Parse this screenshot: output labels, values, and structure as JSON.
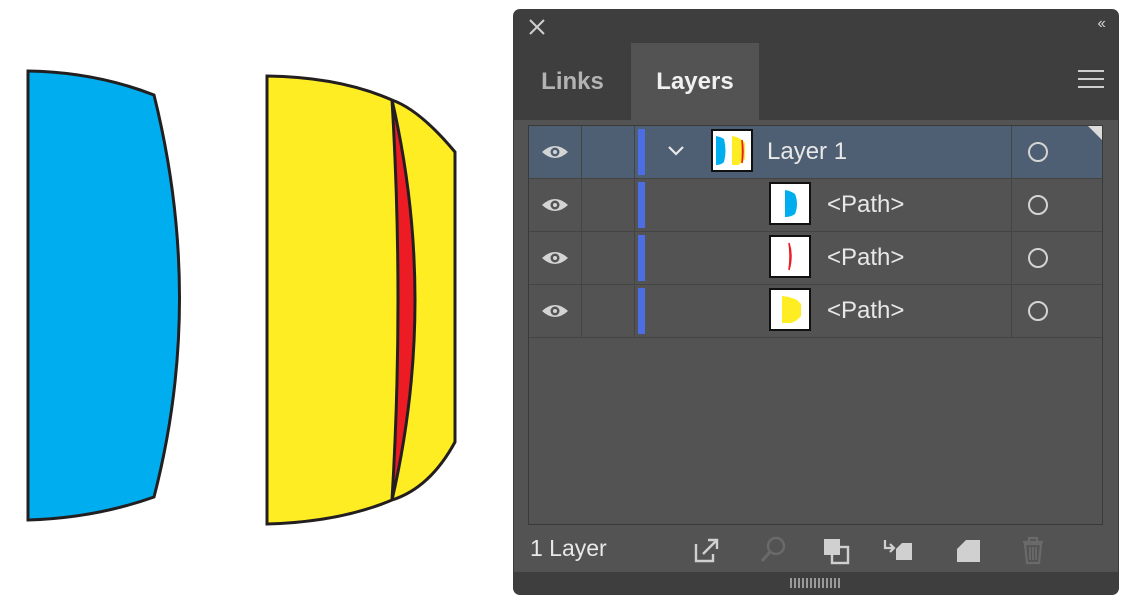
{
  "panel": {
    "tabs": [
      {
        "label": "Links",
        "active": false
      },
      {
        "label": "Layers",
        "active": true
      }
    ],
    "layer_count": "1 Layer",
    "layer_color": "#4c6de3",
    "selection_color": "#4e5f73"
  },
  "layers": [
    {
      "name": "Layer 1",
      "type": "layer",
      "expanded": true,
      "visible": true,
      "selected": true,
      "thumb": "layer-thumb"
    },
    {
      "name": "<Path>",
      "type": "path",
      "visible": true,
      "selected": false,
      "thumb": "blue-shape"
    },
    {
      "name": "<Path>",
      "type": "path",
      "visible": true,
      "selected": false,
      "thumb": "red-shape"
    },
    {
      "name": "<Path>",
      "type": "path",
      "visible": true,
      "selected": false,
      "thumb": "yellow-shape"
    }
  ],
  "footer_buttons": [
    {
      "name": "export-icon",
      "enabled": true
    },
    {
      "name": "locate-object-icon",
      "enabled": false
    },
    {
      "name": "make-clipping-mask-icon",
      "enabled": true
    },
    {
      "name": "create-sublayer-icon",
      "enabled": true
    },
    {
      "name": "create-new-layer-icon",
      "enabled": true
    },
    {
      "name": "delete-icon",
      "enabled": false
    }
  ],
  "artwork": {
    "colors": {
      "blue": "#00aeef",
      "yellow": "#ffed24",
      "red": "#ed1c24",
      "stroke": "#231f20"
    }
  }
}
